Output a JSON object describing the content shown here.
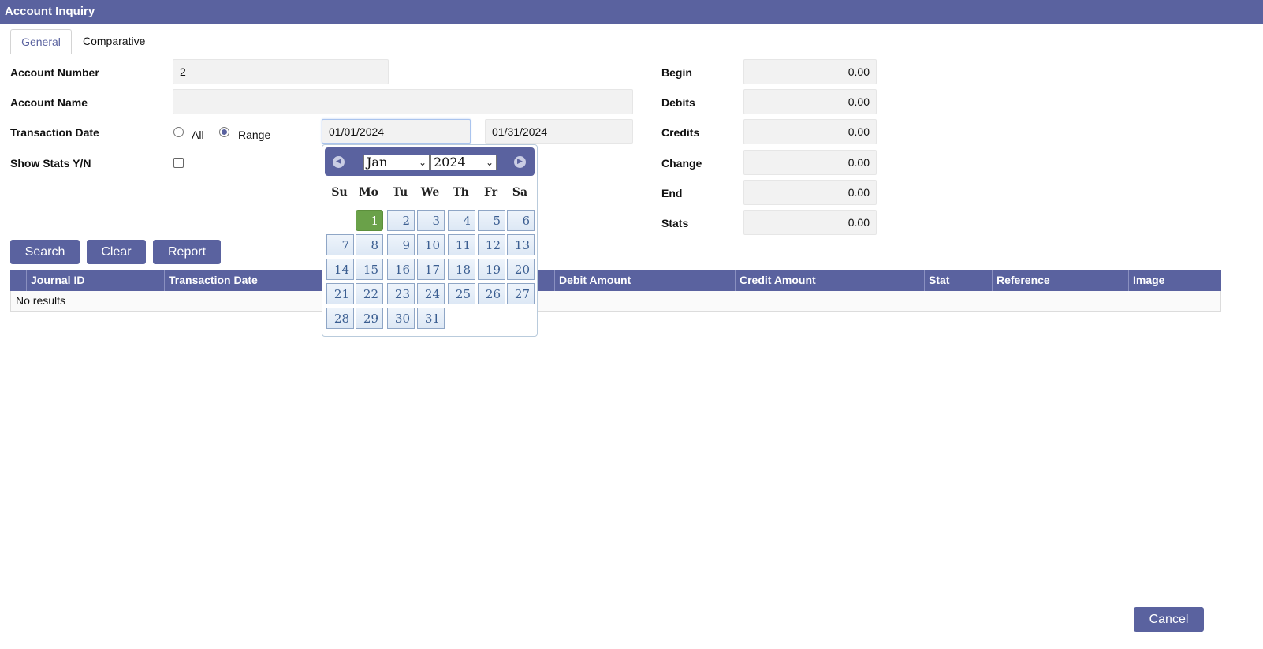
{
  "window": {
    "title": "Account Inquiry"
  },
  "tabs": [
    {
      "label": "General",
      "active": true
    },
    {
      "label": "Comparative",
      "active": false
    }
  ],
  "form": {
    "account_number": {
      "label": "Account Number",
      "value": "2"
    },
    "account_name": {
      "label": "Account Name",
      "value": ""
    },
    "transaction_date": {
      "label": "Transaction Date",
      "option_all": "All",
      "option_range": "Range",
      "selected": "Range",
      "from": "01/01/2024",
      "to": "01/31/2024"
    },
    "show_stats": {
      "label": "Show Stats Y/N",
      "checked": false
    }
  },
  "totals": [
    {
      "label": "Begin",
      "value": "0.00"
    },
    {
      "label": "Debits",
      "value": "0.00"
    },
    {
      "label": "Credits",
      "value": "0.00"
    },
    {
      "label": "Change",
      "value": "0.00"
    },
    {
      "label": "End",
      "value": "0.00"
    },
    {
      "label": "Stats",
      "value": "0.00"
    }
  ],
  "buttons": {
    "search": "Search",
    "clear": "Clear",
    "report": "Report",
    "cancel": "Cancel"
  },
  "grid": {
    "columns": [
      "Journal ID",
      "Transaction Date",
      "Debit Amount",
      "Credit Amount",
      "Stat",
      "Reference",
      "Image"
    ],
    "empty_text": "No results"
  },
  "calendar": {
    "month": "Jan",
    "year": "2024",
    "weekdays": [
      "Su",
      "Mo",
      "Tu",
      "We",
      "Th",
      "Fr",
      "Sa"
    ],
    "first_weekday_index": 1,
    "days_in_month": 31,
    "selected_day": 1
  },
  "colors": {
    "accent": "#5a629f",
    "selected_day": "#6aa149",
    "field_bg": "#f2f2f2"
  }
}
